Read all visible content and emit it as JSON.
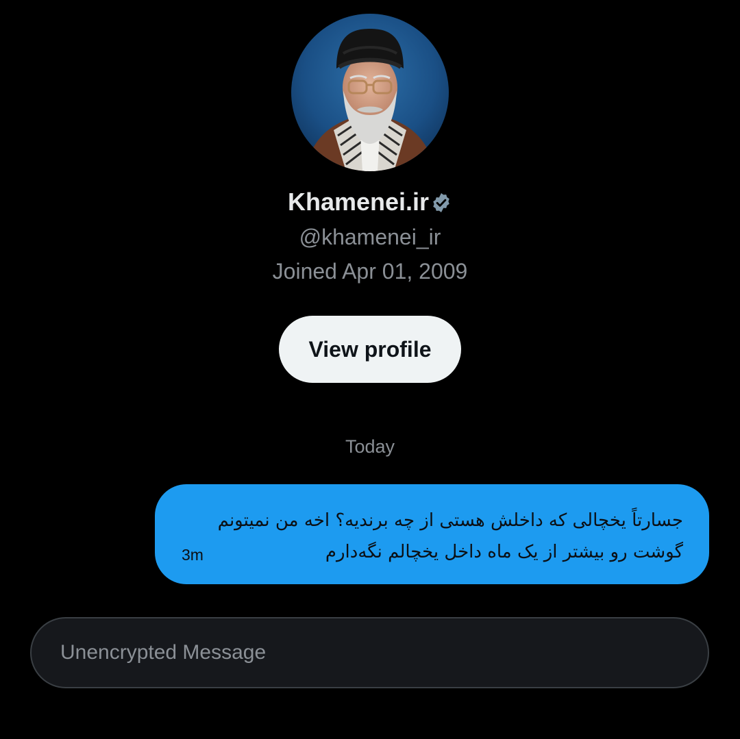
{
  "profile": {
    "avatar_icon": "profile-photo",
    "display_name": "Khamenei.ir",
    "verified_icon": "verified-badge-icon",
    "handle": "@khamenei_ir",
    "joined": "Joined Apr 01, 2009",
    "view_profile_label": "View profile"
  },
  "conversation": {
    "day_separator": "Today",
    "messages": [
      {
        "text": "جسارتاً یخچالی که داخلش هستی از چه برندیه؟ اخه من نمیتونم گوشت رو بیشتر از یک ماه داخل یخچالم نگه‌دارم",
        "time": "3m",
        "direction": "outgoing"
      }
    ]
  },
  "composer": {
    "placeholder": "Unencrypted Message",
    "value": ""
  },
  "colors": {
    "background": "#000000",
    "bubble": "#1d9bf0",
    "muted_text": "#8b9096",
    "button_bg": "#eff3f4",
    "verified_badge": "#829aab"
  }
}
